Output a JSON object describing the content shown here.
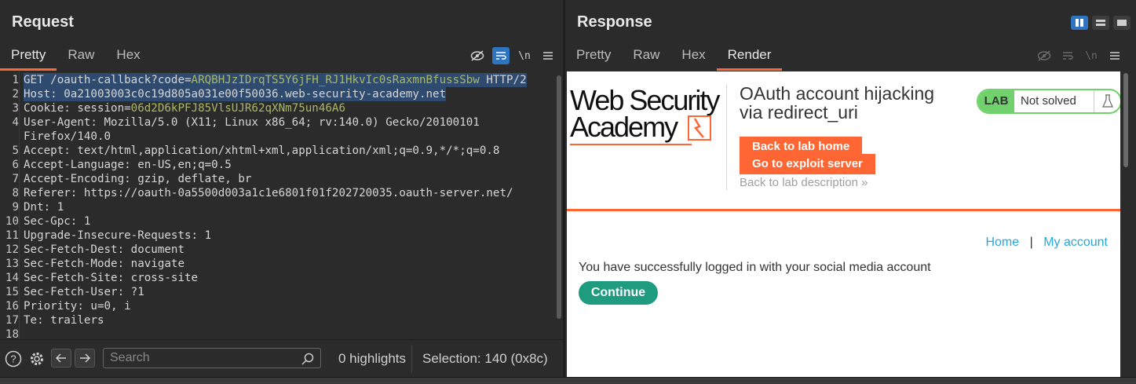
{
  "request": {
    "title": "Request",
    "tabs": [
      "Pretty",
      "Raw",
      "Hex"
    ],
    "lines": [
      {
        "n": "1",
        "key": "GET /oauth-callback?code=",
        "val": "ARQBHJzIDrqTS5Y6jFH_RJ1HkvIc0sRaxmnBfussSbw",
        "tail": " HTTP/2",
        "hl": true
      },
      {
        "n": "2",
        "key": "Host: ",
        "val": "",
        "tail": "0a21003003c0c19d805a031e00f50036.web-security-academy.net",
        "hl": true
      },
      {
        "n": "3",
        "key": "Cookie: session=",
        "val": "06d2D6kPFJ85VlsUJR62qXNm75un46A6",
        "tail": "",
        "hl": false
      },
      {
        "n": "4",
        "key": "User-Agent: ",
        "val": "",
        "tail": "Mozilla/5.0 (X11; Linux x86_64; rv:140.0) Gecko/20100101",
        "hl": false
      },
      {
        "n": "",
        "key": "",
        "val": "",
        "tail": "Firefox/140.0",
        "hl": false
      },
      {
        "n": "5",
        "key": "Accept: ",
        "val": "",
        "tail": "text/html,application/xhtml+xml,application/xml;q=0.9,*/*;q=0.8",
        "hl": false
      },
      {
        "n": "6",
        "key": "Accept-Language: ",
        "val": "",
        "tail": "en-US,en;q=0.5",
        "hl": false
      },
      {
        "n": "7",
        "key": "Accept-Encoding: ",
        "val": "",
        "tail": "gzip, deflate, br",
        "hl": false
      },
      {
        "n": "8",
        "key": "Referer: ",
        "val": "",
        "tail": "https://oauth-0a5500d003a1c1e6801f01f202720035.oauth-server.net/",
        "hl": false
      },
      {
        "n": "9",
        "key": "Dnt: ",
        "val": "",
        "tail": "1",
        "hl": false
      },
      {
        "n": "10",
        "key": "Sec-Gpc: ",
        "val": "",
        "tail": "1",
        "hl": false
      },
      {
        "n": "11",
        "key": "Upgrade-Insecure-Requests: ",
        "val": "",
        "tail": "1",
        "hl": false
      },
      {
        "n": "12",
        "key": "Sec-Fetch-Dest: ",
        "val": "",
        "tail": "document",
        "hl": false
      },
      {
        "n": "13",
        "key": "Sec-Fetch-Mode: ",
        "val": "",
        "tail": "navigate",
        "hl": false
      },
      {
        "n": "14",
        "key": "Sec-Fetch-Site: ",
        "val": "",
        "tail": "cross-site",
        "hl": false
      },
      {
        "n": "15",
        "key": "Sec-Fetch-User: ",
        "val": "",
        "tail": "?1",
        "hl": false
      },
      {
        "n": "16",
        "key": "Priority: ",
        "val": "",
        "tail": "u=0, i",
        "hl": false
      },
      {
        "n": "17",
        "key": "Te: ",
        "val": "",
        "tail": "trailers",
        "hl": false
      },
      {
        "n": "18",
        "key": "",
        "val": "",
        "tail": "",
        "hl": false
      }
    ],
    "search": {
      "placeholder": "Search",
      "highlights": "0 highlights",
      "selection": "Selection: 140 (0x8c)"
    }
  },
  "response": {
    "title": "Response",
    "tabs": [
      "Pretty",
      "Raw",
      "Hex",
      "Render"
    ],
    "render": {
      "logo_line1": "Web Security",
      "logo_line2": "Academy",
      "lab_title_1": "OAuth account hijacking",
      "lab_title_2": "via redirect_uri",
      "back_lab_home": "Back to lab home",
      "exploit_server": "Go to exploit server",
      "back_description": "Back to lab description",
      "desc_chevron": "»",
      "lab_badge": "LAB",
      "lab_status": "Not solved",
      "nav_home": "Home",
      "nav_sep": "|",
      "nav_account": "My account",
      "message": "You have successfully logged in with your social media account",
      "continue": "Continue"
    }
  },
  "colors": {
    "accent": "#ff6633",
    "selection": "#2e4a6f",
    "value": "#a8b86a",
    "lab_green": "#70d16d",
    "link": "#29a7d8",
    "continue": "#1f9b7f"
  }
}
